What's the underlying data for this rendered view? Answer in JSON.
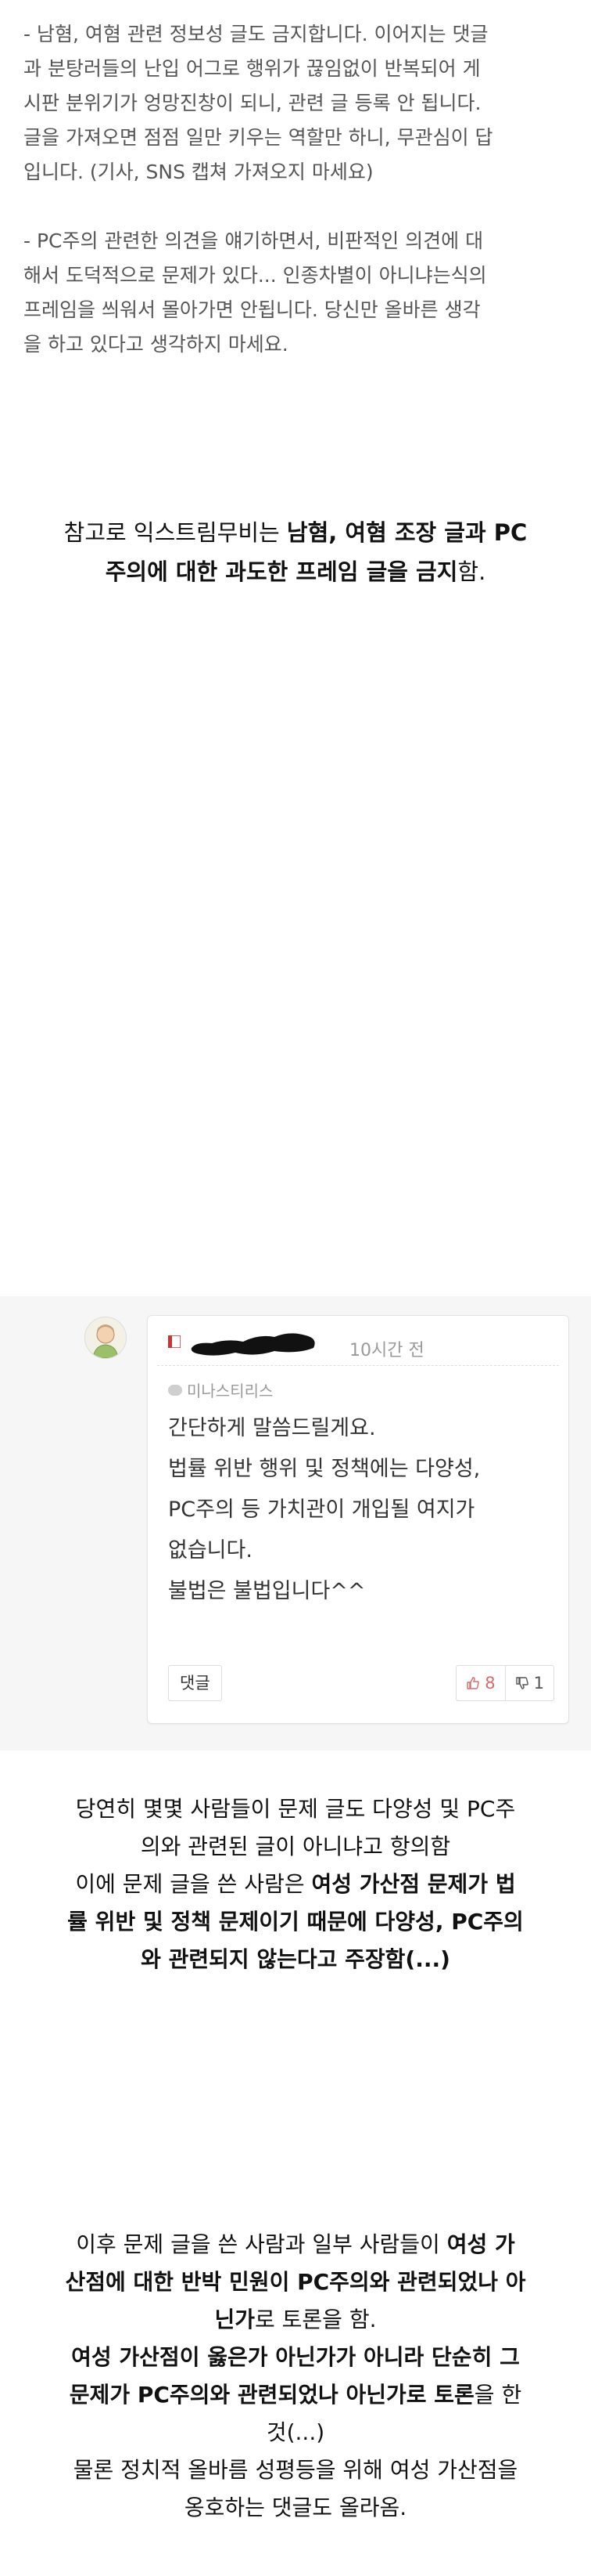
{
  "rules": {
    "para1": [
      "-  남혐, 여혐 관련 정보성 글도 금지합니다. 이어지는 댓글",
      "과 분탕러들의 난입 어그로 행위가 끊임없이 반복되어 게",
      "시판 분위기가 엉망진창이 되니, 관련 글 등록 안 됩니다.",
      "글을 가져오면 점점 일만 키우는 역할만 하니, 무관심이 답",
      "입니다. (기사, SNS 캡쳐 가져오지 마세요)"
    ],
    "para2": [
      "- PC주의 관련한 의견을 얘기하면서, 비판적인 의견에 대",
      "해서 도덕적으로 문제가 있다... 인종차별이 아니냐는식의",
      "프레임을 씌워서 몰아가면 안됩니다. 당신만 올바른 생각",
      "을 하고 있다고 생각하지 마세요."
    ]
  },
  "note": {
    "line1_plain": "참고로 익스트림무비는 ",
    "line1_bold": "남혐, 여혐 조장 글과 PC",
    "line2_bold": "주의에 대한 과도한 프레임 글을 금지",
    "line2_plain": "함."
  },
  "comment": {
    "time": "10시간 전",
    "board": "미나스티리스",
    "lines": [
      "간단하게 말씀드릴게요.",
      "법률 위반 행위 및 정책에는 다양성,",
      "PC주의 등 가치관이 개입될 여지가",
      "없습니다.",
      "불법은 불법입니다^^"
    ],
    "reply_label": "댓글",
    "upvotes": "8",
    "downvotes": "1"
  },
  "story1": {
    "l1": "당연히 몇몇 사람들이 문제 글도 다양성 및 PC주",
    "l2": "의와 관련된 글이 아니냐고 항의함",
    "l3_plain": "이에 문제 글을 쓴 사람은 ",
    "l3_bold": "여성 가산점 문제가 법",
    "l4_bold": "률 위반 및 정책 문제이기 때문에 다양성, PC주의",
    "l5_bold": "와 관련되지 않는다고 주장함(...)"
  },
  "story2": {
    "l1_plain": "이후 문제 글을 쓴 사람과 일부 사람들이 ",
    "l1_bold": "여성 가",
    "l2_bold1": "산점에 대한 반박 민원이 PC주의와 관련되었나 아",
    "l3_bold": "닌가",
    "l3_plain": "로 토론을 함.",
    "l4_bold": "여성 가산점이 옳은가 아닌가가 아니라 단순히 그",
    "l5_bold": "문제가 PC주의와 관련되었나 아닌가로 토론",
    "l5_plain": "을 한",
    "l6": "것(...)",
    "l7": "물론 정치적 올바름 성평등을 위해 여성 가산점을",
    "l8": "옹호하는 댓글도 올라옴."
  }
}
